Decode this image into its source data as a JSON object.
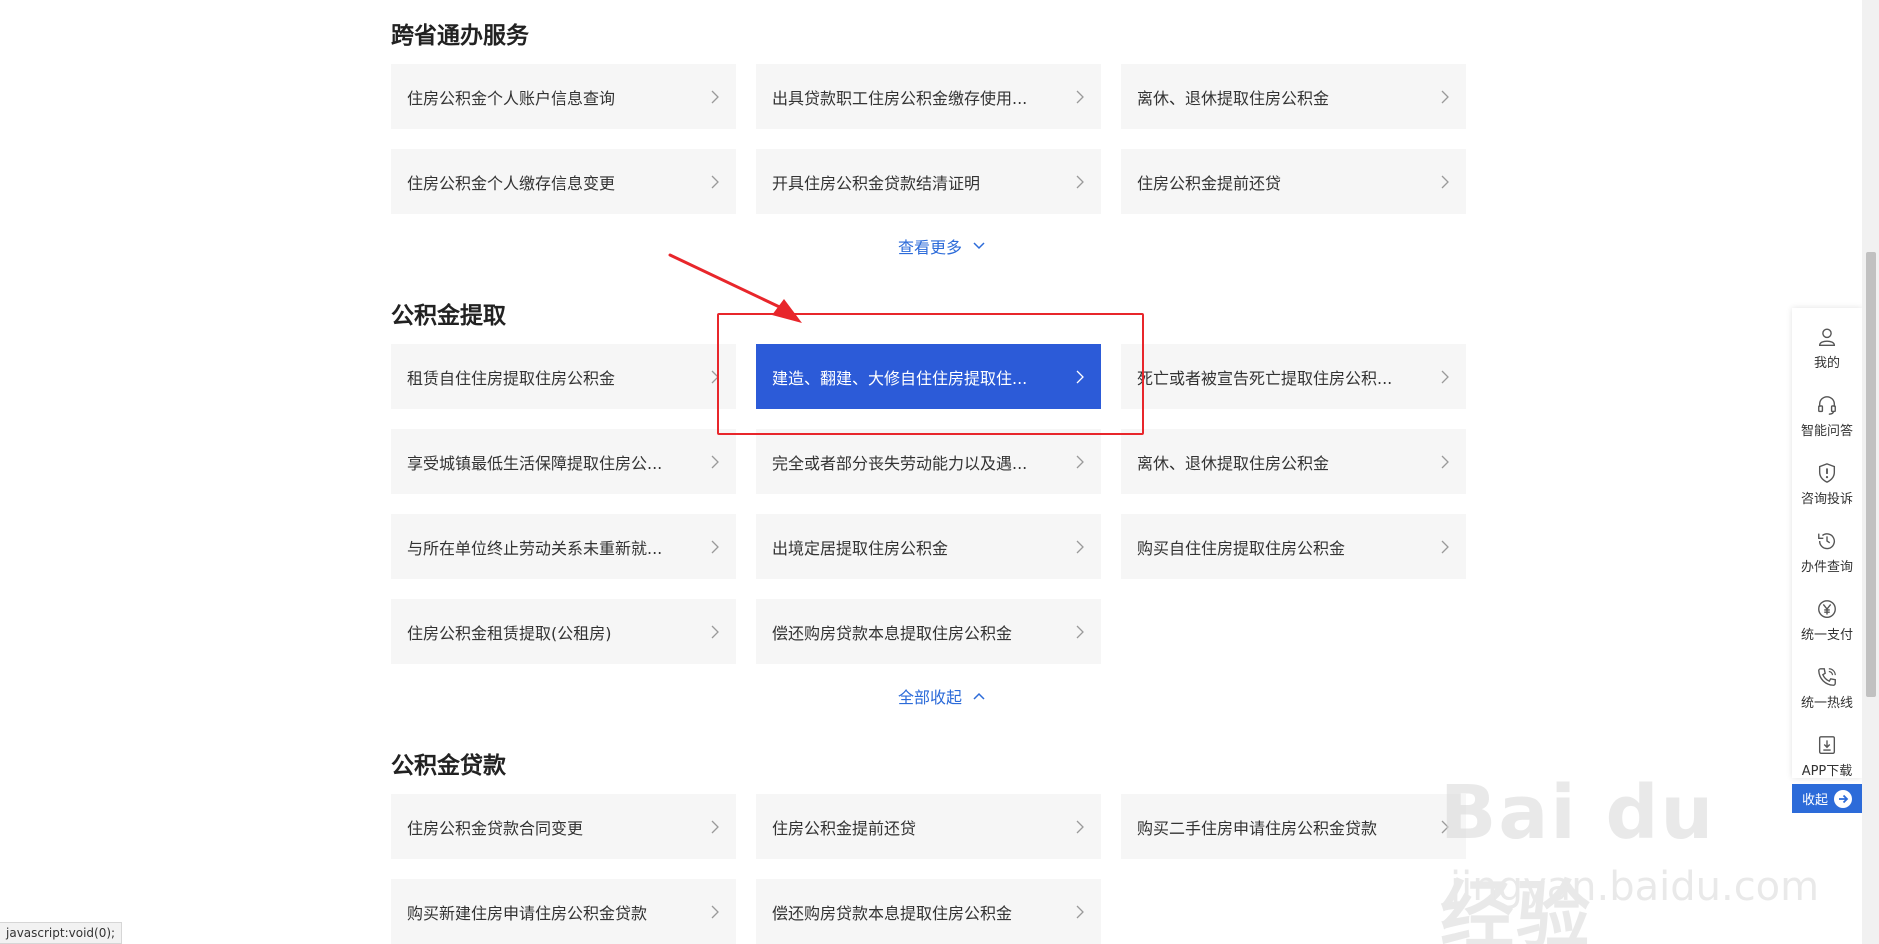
{
  "sections": [
    {
      "title": "跨省通办服务",
      "items": [
        "住房公积金个人账户信息查询",
        "出具贷款职工住房公积金缴存使用...",
        "离休、退休提取住房公积金",
        "住房公积金个人缴存信息变更",
        "开具住房公积金贷款结清证明",
        "住房公积金提前还贷"
      ],
      "toggle_label": "查看更多"
    },
    {
      "title": "公积金提取",
      "items": [
        "租赁自住住房提取住房公积金",
        "建造、翻建、大修自住住房提取住...",
        "死亡或者被宣告死亡提取住房公积...",
        "享受城镇最低生活保障提取住房公...",
        "完全或者部分丧失劳动能力以及遇...",
        "离休、退休提取住房公积金",
        "与所在单位终止劳动关系未重新就...",
        "出境定居提取住房公积金",
        "购买自住住房提取住房公积金",
        "住房公积金租赁提取(公租房)",
        "偿还购房贷款本息提取住房公积金"
      ],
      "toggle_label": "全部收起"
    },
    {
      "title": "公积金贷款",
      "items": [
        "住房公积金贷款合同变更",
        "住房公积金提前还贷",
        "购买二手住房申请住房公积金贷款",
        "购买新建住房申请住房公积金贷款",
        "偿还购房贷款本息提取住房公积金"
      ]
    }
  ],
  "sidebar": {
    "items": [
      {
        "label": "我的",
        "icon": "user-icon"
      },
      {
        "label": "智能问答",
        "icon": "headset-icon"
      },
      {
        "label": "咨询投诉",
        "icon": "shield-alert-icon"
      },
      {
        "label": "办件查询",
        "icon": "history-icon"
      },
      {
        "label": "统一支付",
        "icon": "yen-icon"
      },
      {
        "label": "统一热线",
        "icon": "phone-icon"
      },
      {
        "label": "APP下载",
        "icon": "download-icon"
      }
    ],
    "collapse_label": "收起"
  },
  "status_bar": "javascript:void(0);",
  "watermark": {
    "brand": "Bai du 经验",
    "url": "jingyan.baidu.com"
  },
  "colors": {
    "accent": "#2c6bd9",
    "active_card": "#2c5bd8",
    "annotation": "#e8262b",
    "card_bg": "#f6f6f6"
  }
}
